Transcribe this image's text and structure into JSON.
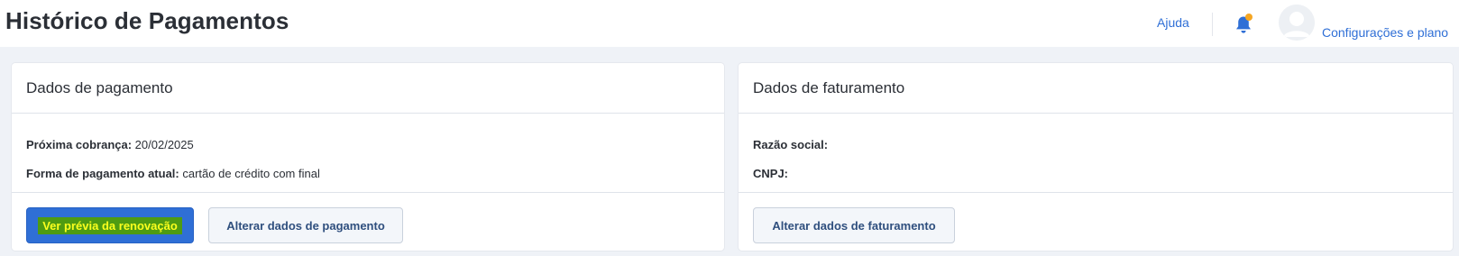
{
  "header": {
    "title": "Histórico de Pagamentos",
    "help_label": "Ajuda",
    "settings_label": "Configurações e plano",
    "notification_dot_color": "#f5a623",
    "icons": [
      "bell-icon",
      "user-avatar-icon"
    ]
  },
  "payment_card": {
    "title": "Dados de pagamento",
    "next_charge_label": "Próxima cobrança:",
    "next_charge_value": "20/02/2025",
    "payment_method_label": "Forma de pagamento atual:",
    "payment_method_value": "cartão de crédito com final",
    "preview_button_label": "Ver prévia da renovação",
    "change_payment_button_label": "Alterar dados de pagamento"
  },
  "billing_card": {
    "title": "Dados de faturamento",
    "company_label": "Razão social:",
    "company_value": "",
    "cnpj_label": "CNPJ:",
    "cnpj_value": "",
    "change_billing_button_label": "Alterar dados de faturamento"
  },
  "colors": {
    "accent": "#2f6fd6",
    "background": "#eff2f7",
    "highlight_bg": "#4e9b12",
    "highlight_text": "#fbff1e"
  }
}
